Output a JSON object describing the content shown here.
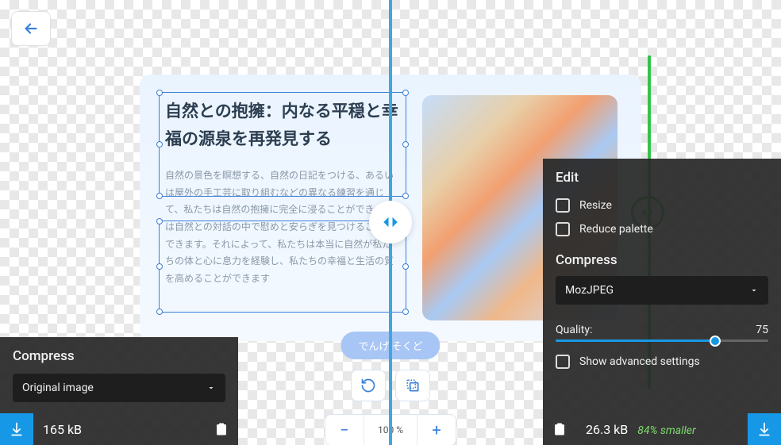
{
  "back": {},
  "canvas": {
    "headline": "自然との抱擁：内なる平穏と幸福の源泉を再発見する",
    "body": "自然の景色を瞑想する、自然の日記をつける、あるいは屋外の手工芸に取り組むなどの異なる練習を通じて、私たちは自然の抱擁に完全に浸ることができ、魂は自然との対話の中で慰めと安らぎを見つけることができます。それによって、私たちは本当に自然が私たちの体と心に息力を経験し、私たちの幸福と生活の質を高めることができます",
    "cta_label": "でんげ そくど"
  },
  "zoom": {
    "value": "100 %"
  },
  "left_panel": {
    "title": "Compress",
    "source_label": "Original image",
    "filesize": "165 kB"
  },
  "right_panel": {
    "edit_title": "Edit",
    "resize_label": "Resize",
    "reduce_label": "Reduce palette",
    "compress_title": "Compress",
    "codec": "MozJPEG",
    "quality_label": "Quality:",
    "quality_value": "75",
    "quality_pct": 75,
    "advanced_label": "Show advanced settings",
    "filesize": "26.3 kB",
    "savings": "84% smaller"
  }
}
